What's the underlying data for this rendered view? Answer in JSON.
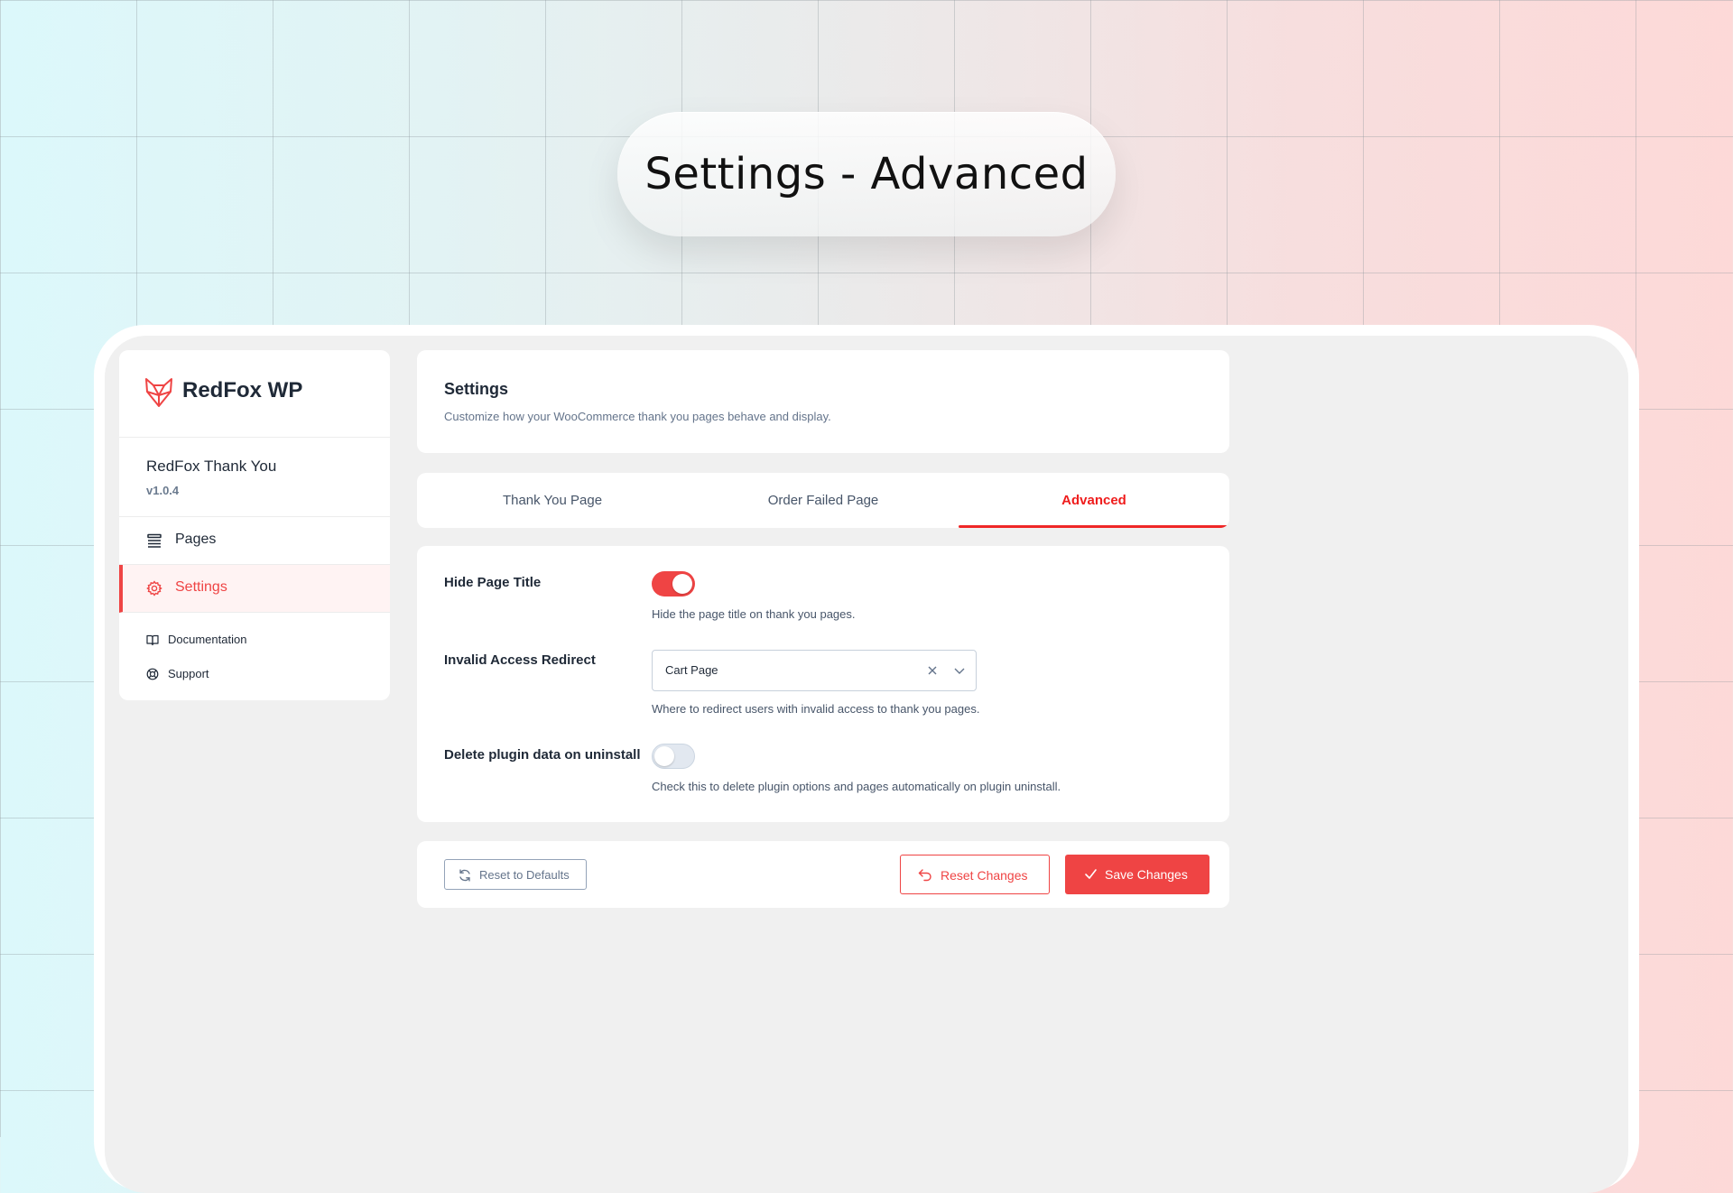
{
  "hero": {
    "title": "Settings - Advanced"
  },
  "brand": {
    "name": "RedFox WP",
    "logo_icon": "fox-logo-icon",
    "accent": "#ef4444"
  },
  "plugin": {
    "name": "RedFox Thank You",
    "version": "v1.0.4"
  },
  "sidebar": {
    "items": [
      {
        "label": "Pages",
        "icon": "list-icon",
        "active": false
      },
      {
        "label": "Settings",
        "icon": "gear-icon",
        "active": true
      }
    ],
    "links": [
      {
        "label": "Documentation",
        "icon": "book-icon"
      },
      {
        "label": "Support",
        "icon": "lifebuoy-icon"
      }
    ]
  },
  "header": {
    "title": "Settings",
    "subtitle": "Customize how your WooCommerce thank you pages behave and display."
  },
  "tabs": [
    {
      "label": "Thank You Page",
      "active": false
    },
    {
      "label": "Order Failed Page",
      "active": false
    },
    {
      "label": "Advanced",
      "active": true
    }
  ],
  "options": {
    "hide_title": {
      "label": "Hide Page Title",
      "enabled": true,
      "help": "Hide the page title on thank you pages."
    },
    "redirect": {
      "label": "Invalid Access Redirect",
      "value": "Cart Page",
      "help": "Where to redirect users with invalid access to thank you pages."
    },
    "delete_data": {
      "label": "Delete plugin data on uninstall",
      "enabled": false,
      "help": "Check this to delete plugin options and pages automatically on plugin uninstall."
    }
  },
  "footer": {
    "reset_defaults": "Reset to Defaults",
    "reset_changes": "Reset Changes",
    "save_changes": "Save Changes"
  }
}
